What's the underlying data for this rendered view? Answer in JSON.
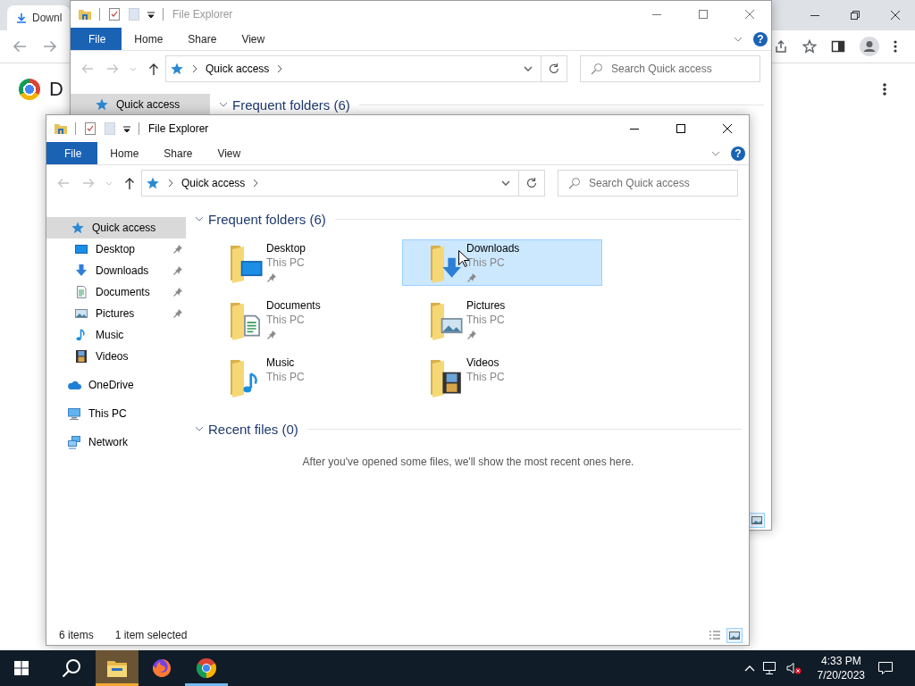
{
  "chrome": {
    "tab": {
      "title": "Downl"
    },
    "page_heading": "D"
  },
  "back_window": {
    "title": "File Explorer",
    "active": false,
    "help": "?",
    "ribbon_tabs": [
      {
        "label": "File",
        "selected": true
      },
      {
        "label": "Home",
        "selected": false
      },
      {
        "label": "Share",
        "selected": false
      },
      {
        "label": "View",
        "selected": false
      }
    ],
    "address": {
      "crumbs": [
        "Quick access"
      ]
    },
    "search": {
      "placeholder": "Search Quick access"
    },
    "nav": [
      {
        "label": "Quick access",
        "kind": "quick",
        "selected": true
      }
    ],
    "sections": [
      {
        "heading": "Frequent folders (6)",
        "expanded": true
      }
    ],
    "view_buttons": [
      {
        "kind": "large_icons",
        "selected": true
      }
    ]
  },
  "window": {
    "title": "File Explorer",
    "active": true,
    "help": "?",
    "ribbon_tabs": [
      {
        "label": "File",
        "selected": true
      },
      {
        "label": "Home",
        "selected": false
      },
      {
        "label": "Share",
        "selected": false
      },
      {
        "label": "View",
        "selected": false
      }
    ],
    "address": {
      "crumbs": [
        "Quick access"
      ]
    },
    "search": {
      "placeholder": "Search Quick access"
    },
    "nav": [
      {
        "label": "Quick access",
        "kind": "quick",
        "selected": true,
        "children": [
          {
            "label": "Desktop",
            "kind": "desktop",
            "selected": false,
            "pinned": true
          },
          {
            "label": "Downloads",
            "kind": "downloads",
            "selected": false,
            "pinned": true
          },
          {
            "label": "Documents",
            "kind": "documents",
            "selected": false,
            "pinned": true
          },
          {
            "label": "Pictures",
            "kind": "pictures",
            "selected": false,
            "pinned": true
          },
          {
            "label": "Music",
            "kind": "music",
            "selected": false,
            "pinned": false
          },
          {
            "label": "Videos",
            "kind": "videos",
            "selected": false,
            "pinned": false
          }
        ]
      },
      {
        "label": "OneDrive",
        "kind": "onedrive",
        "selected": false
      },
      {
        "label": "This PC",
        "kind": "pc",
        "selected": false
      },
      {
        "label": "Network",
        "kind": "network",
        "selected": false
      }
    ],
    "sections": [
      {
        "heading": "Frequent folders (6)",
        "expanded": true,
        "folders": [
          {
            "name": "Desktop",
            "location": "This PC",
            "kind": "desktop",
            "pinned": true,
            "selected": false
          },
          {
            "name": "Downloads",
            "location": "This PC",
            "kind": "downloads",
            "pinned": true,
            "selected": true
          },
          {
            "name": "Documents",
            "location": "This PC",
            "kind": "documents",
            "pinned": true,
            "selected": false
          },
          {
            "name": "Pictures",
            "location": "This PC",
            "kind": "pictures",
            "pinned": true,
            "selected": false
          },
          {
            "name": "Music",
            "location": "This PC",
            "kind": "music",
            "pinned": false,
            "selected": false
          },
          {
            "name": "Videos",
            "location": "This PC",
            "kind": "videos",
            "pinned": false,
            "selected": false
          }
        ]
      },
      {
        "heading": "Recent files (0)",
        "expanded": true,
        "message": "After you've opened some files, we'll show the most recent ones here."
      }
    ],
    "status_bar": {
      "items": "6 items",
      "selection": "1 item selected"
    },
    "view_buttons": [
      {
        "kind": "details",
        "selected": false
      },
      {
        "kind": "large_icons",
        "selected": true
      }
    ]
  },
  "taskbar": {
    "apps": [
      {
        "kind": "explorer",
        "active": true,
        "running": true
      },
      {
        "kind": "firefox",
        "active": false,
        "running": false
      },
      {
        "kind": "chrome",
        "active": false,
        "running": true
      }
    ],
    "time": "4:33 PM",
    "date": "7/20/2023"
  }
}
